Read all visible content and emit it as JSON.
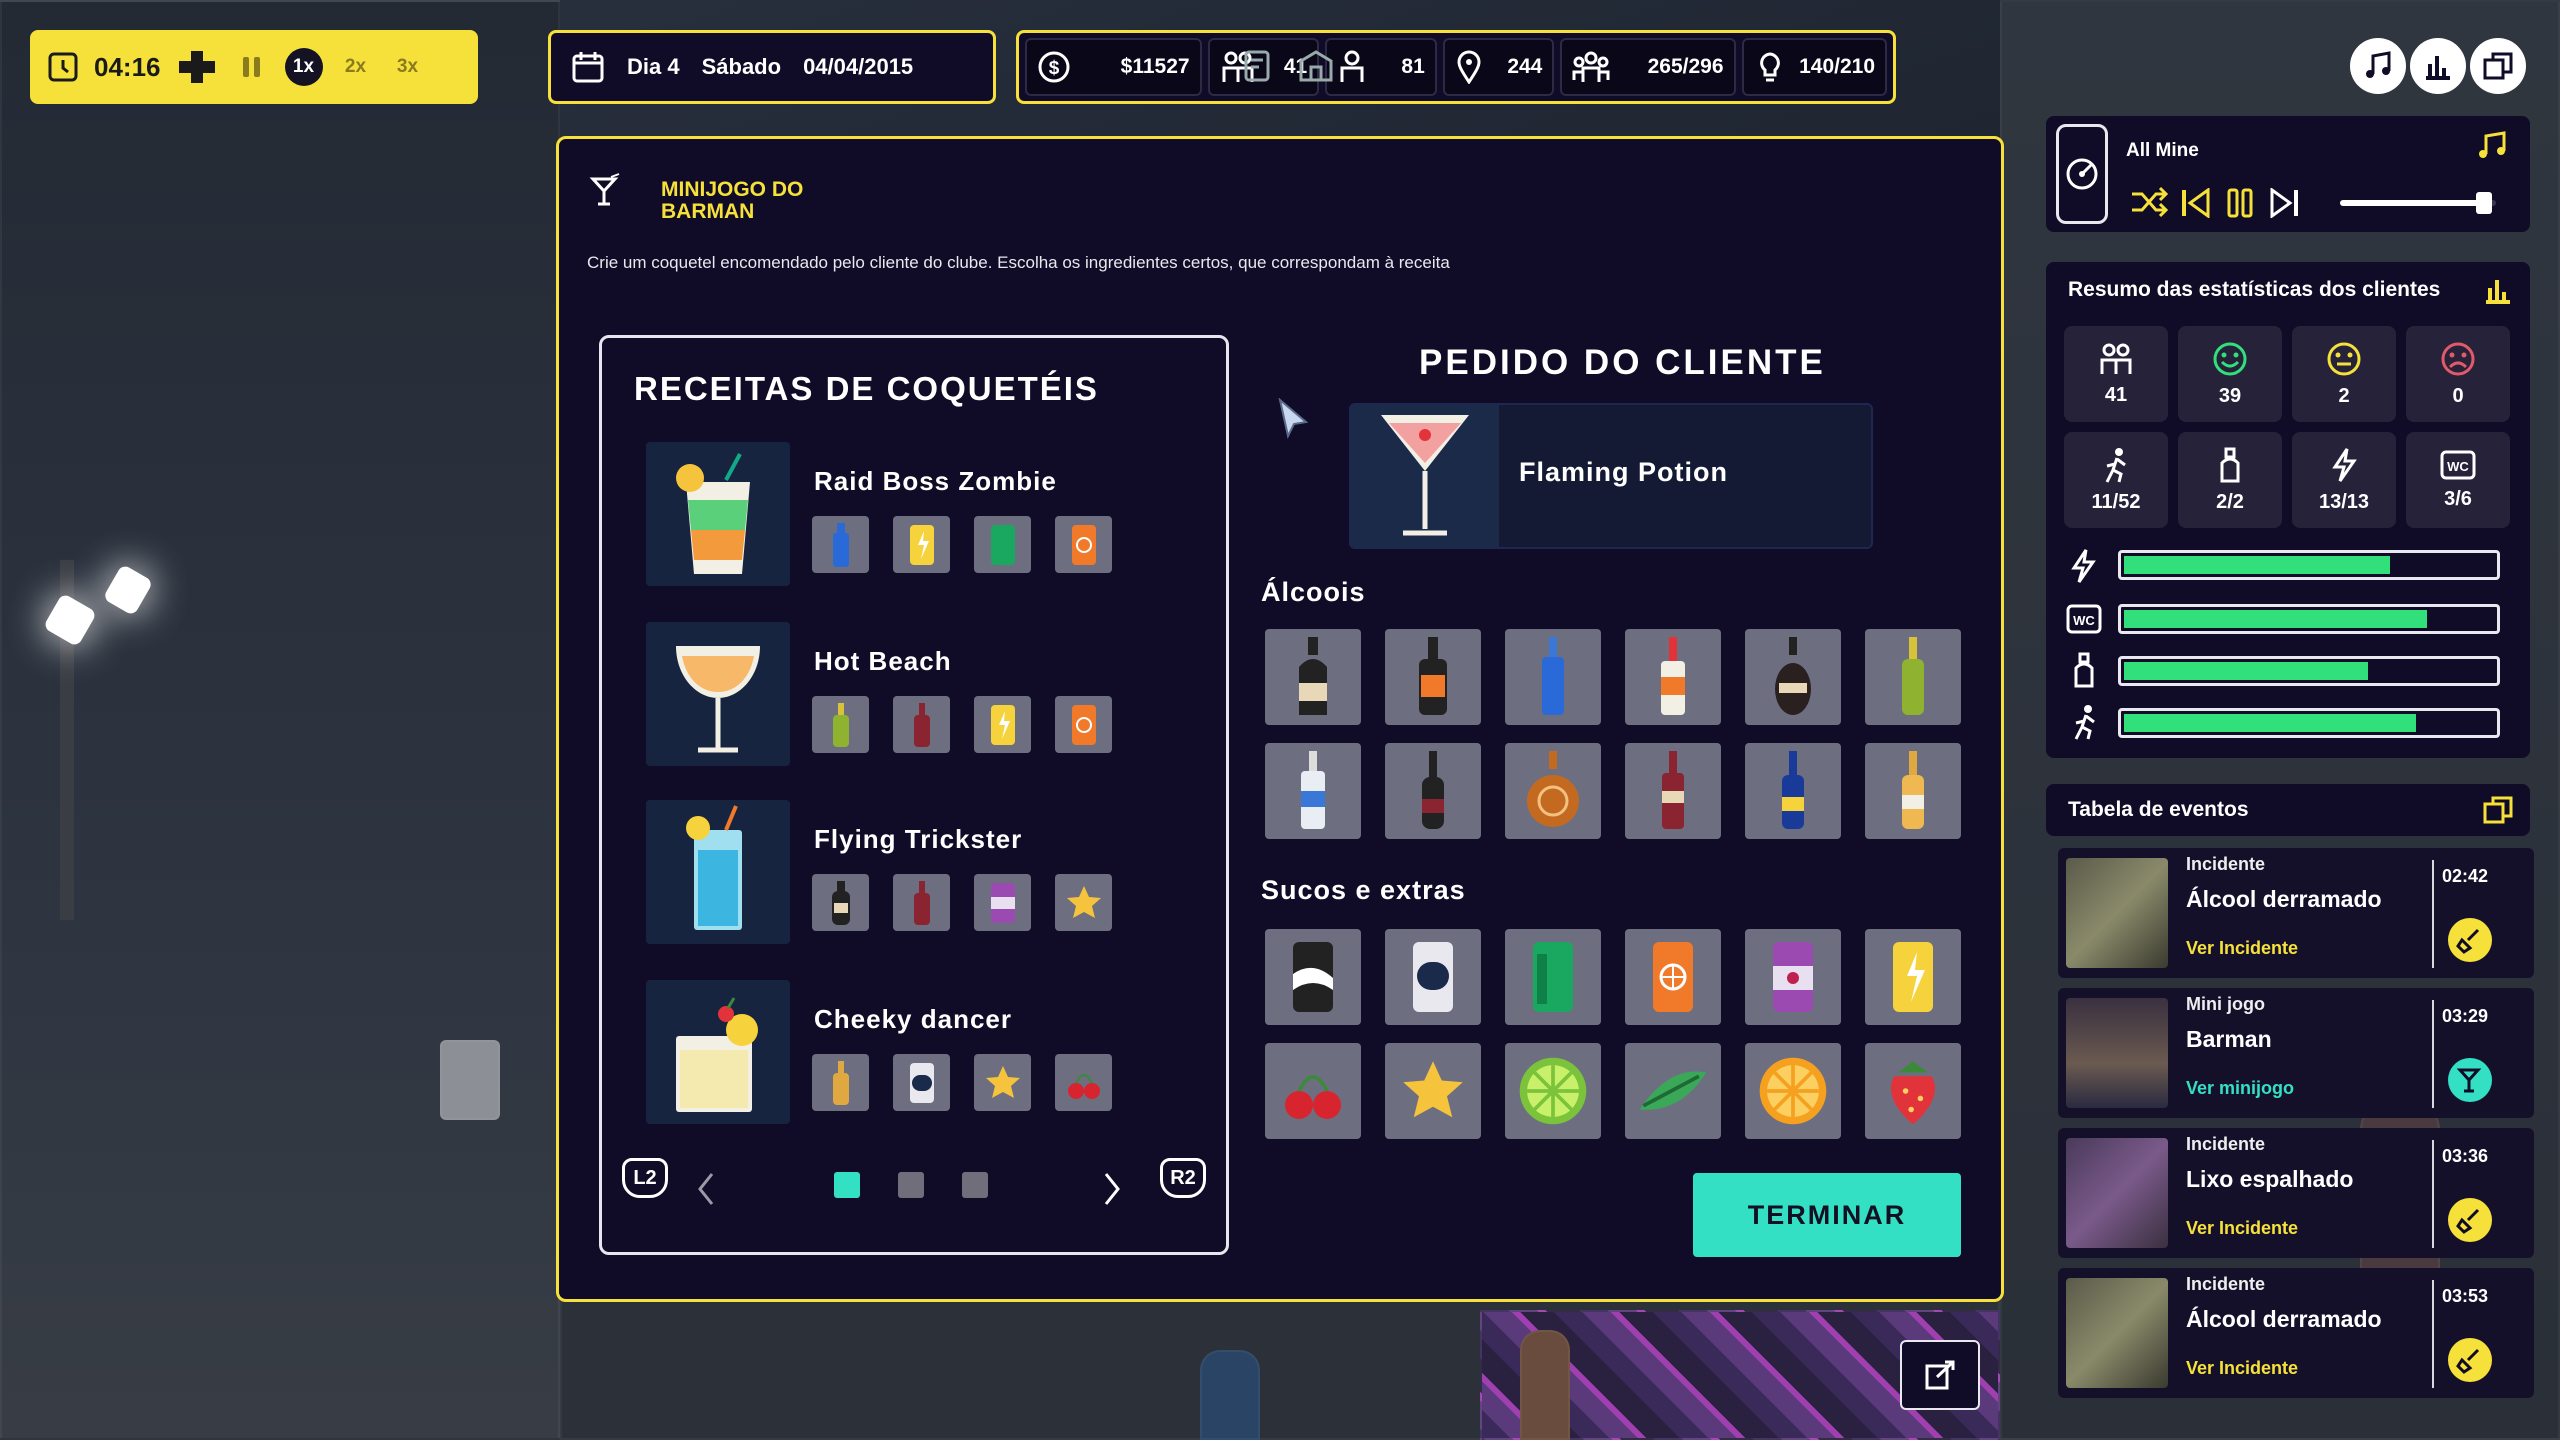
{
  "hud": {
    "time": "04:16",
    "speeds": [
      "1x",
      "2x",
      "3x"
    ],
    "day_label": "Dia 4",
    "weekday": "Sábado",
    "date": "04/04/2015",
    "money": "$11527",
    "guests": "41",
    "staff": "81",
    "location": "244",
    "capacity": "265/296",
    "power": "140/210"
  },
  "minigame": {
    "title": "MINIJOGO DO BARMAN",
    "description": "Crie um coquetel encomendado pelo cliente do clube. Escolha os ingredientes certos, que correspondam à receita",
    "recipes_title": "RECEITAS DE COQUETÉIS",
    "recipes": [
      {
        "name": "Raid Boss Zombie",
        "ingredients": [
          "blue-bottle-icon",
          "energy-can-icon",
          "green-can-icon",
          "orange-can-icon"
        ]
      },
      {
        "name": "Hot Beach",
        "ingredients": [
          "green-bottle-icon",
          "red-bottle-icon",
          "energy-can-icon",
          "orange-can-icon"
        ]
      },
      {
        "name": "Flying Trickster",
        "ingredients": [
          "dark-bottle-icon",
          "red-bottle-icon",
          "purple-can-icon",
          "star-fruit-icon"
        ]
      },
      {
        "name": "Cheeky dancer",
        "ingredients": [
          "gold-bottle-icon",
          "navy-can-icon",
          "star-fruit-icon",
          "cherry-icon"
        ]
      }
    ],
    "pager": {
      "left_button": "L2",
      "right_button": "R2",
      "pages": 3,
      "current_page": 1
    },
    "order_title": "PEDIDO DO CLIENTE",
    "order_name": "Flaming Potion",
    "alcohols_label": "Álcoois",
    "juices_label": "Sucos e extras",
    "alcohols": [
      "cream-liqueur-icon",
      "whiskey-bottle-icon",
      "blue-bottle-icon",
      "orange-label-bottle-icon",
      "dark-liqueur-icon",
      "green-bottle-icon",
      "clear-bottle-icon",
      "wine-bottle-icon",
      "cognac-bottle-icon",
      "red-liquor-icon",
      "navy-bottle-icon",
      "gold-bottle-icon"
    ],
    "juices": [
      "black-can-icon",
      "white-can-icon",
      "green-can-icon",
      "orange-can-icon",
      "purple-can-icon",
      "energy-can-icon",
      "cherry-icon",
      "star-fruit-icon",
      "lime-icon",
      "mint-icon",
      "orange-slice-icon",
      "strawberry-icon"
    ],
    "finish_label": "TERMINAR"
  },
  "music": {
    "track": "All Mine",
    "volume": 0.92
  },
  "client_stats": {
    "title": "Resumo das estatísticas dos clientes",
    "row1": [
      {
        "icon": "people-icon",
        "value": "41"
      },
      {
        "icon": "happy-face-icon",
        "value": "39"
      },
      {
        "icon": "neutral-face-icon",
        "value": "2"
      },
      {
        "icon": "sad-face-icon",
        "value": "0"
      }
    ],
    "row2": [
      {
        "icon": "dancer-icon",
        "value": "11/52"
      },
      {
        "icon": "bottle-icon",
        "value": "2/2"
      },
      {
        "icon": "lightning-icon",
        "value": "13/13"
      },
      {
        "icon": "wc-icon",
        "value": "3/6"
      }
    ],
    "bars": [
      {
        "icon": "lightning-icon",
        "level": 0.72
      },
      {
        "icon": "wc-icon",
        "level": 0.82
      },
      {
        "icon": "bottle-icon",
        "level": 0.66
      },
      {
        "icon": "dancer-icon",
        "level": 0.79
      }
    ]
  },
  "events": {
    "title": "Tabela de eventos",
    "items": [
      {
        "category": "Incidente",
        "title": "Álcool derramado",
        "link": "Ver Incidente",
        "time": "02:42",
        "kind": "incident"
      },
      {
        "category": "Mini jogo",
        "title": "Barman",
        "link": "Ver minijogo",
        "time": "03:29",
        "kind": "minigame"
      },
      {
        "category": "Incidente",
        "title": "Lixo espalhado",
        "link": "Ver Incidente",
        "time": "03:36",
        "kind": "incident"
      },
      {
        "category": "Incidente",
        "title": "Álcool derramado",
        "link": "Ver Incidente",
        "time": "03:53",
        "kind": "incident"
      }
    ]
  },
  "colors": {
    "accent": "#f6e13b",
    "panel": "#100b26",
    "teal": "#33e0c4",
    "bar_green": "#31e07a"
  }
}
